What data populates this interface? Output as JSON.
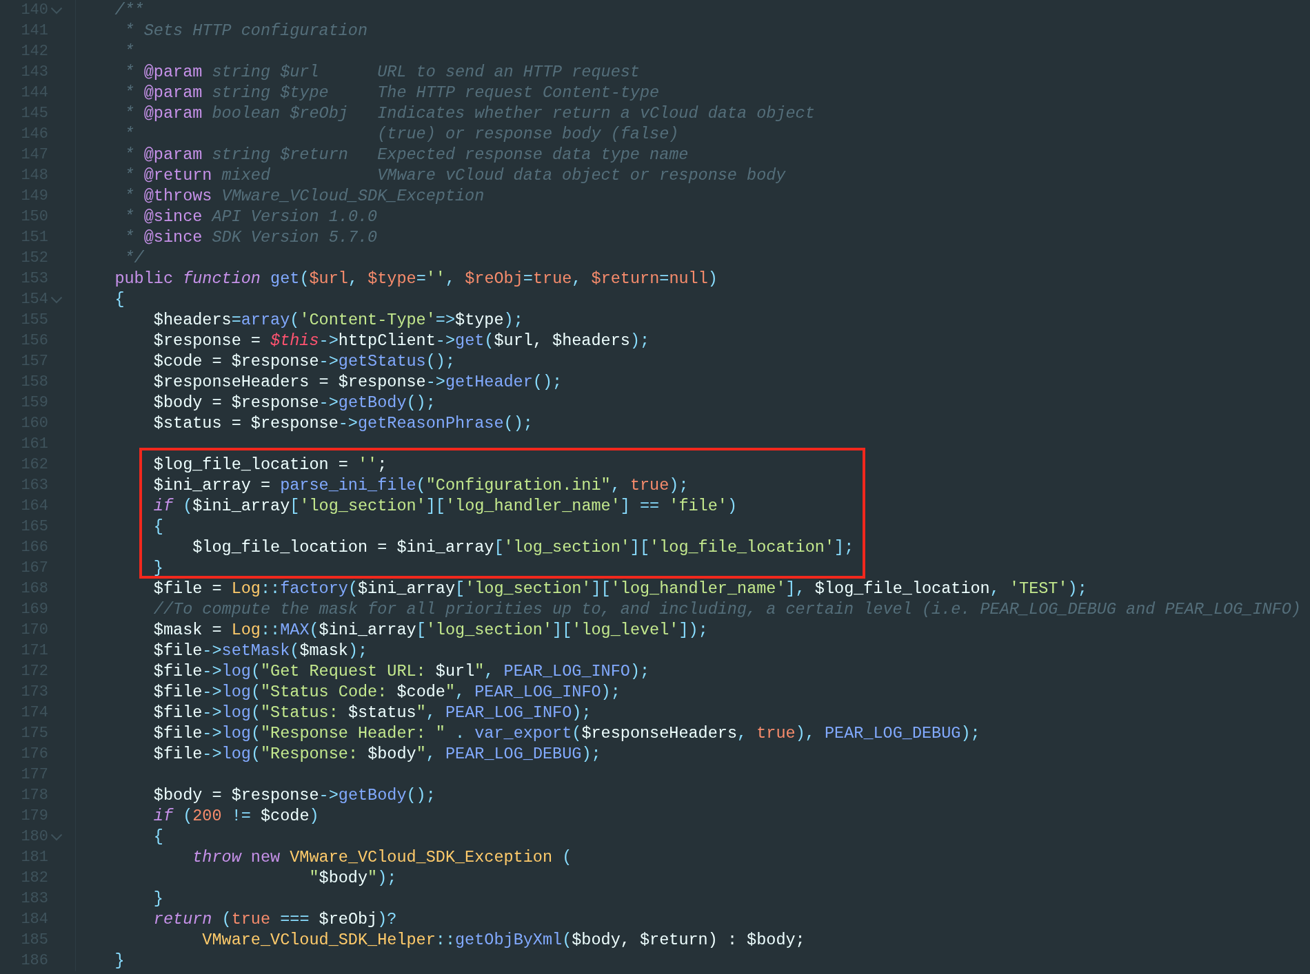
{
  "editor": {
    "segments": [
      {
        "kind": "plain",
        "lines": [
          {
            "number": "140",
            "foldable": true,
            "tokens": [
              {
                "kind": "comment",
                "text": "    /**"
              }
            ]
          },
          {
            "number": "141",
            "foldable": false,
            "tokens": [
              {
                "kind": "comment",
                "text": "     * Sets HTTP configuration"
              }
            ]
          },
          {
            "number": "142",
            "foldable": false,
            "tokens": [
              {
                "kind": "comment",
                "text": "     *"
              }
            ]
          },
          {
            "number": "143",
            "foldable": false,
            "tokens": [
              {
                "kind": "comment",
                "text": "     * "
              },
              {
                "kind": "doc-tag",
                "text": "@param"
              },
              {
                "kind": "comment",
                "text": " string $url      URL to send an HTTP request"
              }
            ]
          },
          {
            "number": "144",
            "foldable": false,
            "tokens": [
              {
                "kind": "comment",
                "text": "     * "
              },
              {
                "kind": "doc-tag",
                "text": "@param"
              },
              {
                "kind": "comment",
                "text": " string $type     The HTTP request Content-type"
              }
            ]
          },
          {
            "number": "145",
            "foldable": false,
            "tokens": [
              {
                "kind": "comment",
                "text": "     * "
              },
              {
                "kind": "doc-tag",
                "text": "@param"
              },
              {
                "kind": "comment",
                "text": " boolean $reObj   Indicates whether return a vCloud data object"
              }
            ]
          },
          {
            "number": "146",
            "foldable": false,
            "tokens": [
              {
                "kind": "comment",
                "text": "     *                         (true) or response body (false)"
              }
            ]
          },
          {
            "number": "147",
            "foldable": false,
            "tokens": [
              {
                "kind": "comment",
                "text": "     * "
              },
              {
                "kind": "doc-tag",
                "text": "@param"
              },
              {
                "kind": "comment",
                "text": " string $return   Expected response data type name"
              }
            ]
          },
          {
            "number": "148",
            "foldable": false,
            "tokens": [
              {
                "kind": "comment",
                "text": "     * "
              },
              {
                "kind": "doc-tag",
                "text": "@return"
              },
              {
                "kind": "comment",
                "text": " mixed           VMware vCloud data object or response body"
              }
            ]
          },
          {
            "number": "149",
            "foldable": false,
            "tokens": [
              {
                "kind": "comment",
                "text": "     * "
              },
              {
                "kind": "doc-tag",
                "text": "@throws"
              },
              {
                "kind": "comment",
                "text": " VMware_VCloud_SDK_Exception"
              }
            ]
          },
          {
            "number": "150",
            "foldable": false,
            "tokens": [
              {
                "kind": "comment",
                "text": "     * "
              },
              {
                "kind": "doc-tag",
                "text": "@since"
              },
              {
                "kind": "comment",
                "text": " API Version 1.0.0"
              }
            ]
          },
          {
            "number": "151",
            "foldable": false,
            "tokens": [
              {
                "kind": "comment",
                "text": "     * "
              },
              {
                "kind": "doc-tag",
                "text": "@since"
              },
              {
                "kind": "comment",
                "text": " SDK Version 5.7.0"
              }
            ]
          },
          {
            "number": "152",
            "foldable": false,
            "tokens": [
              {
                "kind": "comment",
                "text": "     */"
              }
            ]
          },
          {
            "number": "153",
            "foldable": false,
            "tokens": [
              {
                "kind": "storage",
                "text": "    public "
              },
              {
                "kind": "keyword",
                "text": "function "
              },
              {
                "kind": "function",
                "text": "get"
              },
              {
                "kind": "punct",
                "text": "("
              },
              {
                "kind": "param",
                "text": "$url"
              },
              {
                "kind": "punct",
                "text": ", "
              },
              {
                "kind": "param",
                "text": "$type"
              },
              {
                "kind": "punct",
                "text": "="
              },
              {
                "kind": "string",
                "text": "''"
              },
              {
                "kind": "punct",
                "text": ", "
              },
              {
                "kind": "param",
                "text": "$reObj"
              },
              {
                "kind": "punct",
                "text": "="
              },
              {
                "kind": "literal",
                "text": "true"
              },
              {
                "kind": "punct",
                "text": ", "
              },
              {
                "kind": "param",
                "text": "$return"
              },
              {
                "kind": "punct",
                "text": "="
              },
              {
                "kind": "literal",
                "text": "null"
              },
              {
                "kind": "punct",
                "text": ")"
              }
            ]
          },
          {
            "number": "154",
            "foldable": true,
            "tokens": [
              {
                "kind": "punct",
                "text": "    {"
              }
            ]
          },
          {
            "number": "155",
            "foldable": false,
            "tokens": [
              {
                "kind": "plain",
                "text": "        $headers"
              },
              {
                "kind": "punct",
                "text": "="
              },
              {
                "kind": "function",
                "text": "array"
              },
              {
                "kind": "punct",
                "text": "("
              },
              {
                "kind": "string",
                "text": "'Content-Type'"
              },
              {
                "kind": "punct",
                "text": "=>"
              },
              {
                "kind": "plain",
                "text": "$type"
              },
              {
                "kind": "punct",
                "text": ");"
              }
            ]
          },
          {
            "number": "156",
            "foldable": false,
            "tokens": [
              {
                "kind": "plain",
                "text": "        $response = "
              },
              {
                "kind": "this",
                "text": "$this"
              },
              {
                "kind": "punct",
                "text": "->"
              },
              {
                "kind": "plain",
                "text": "httpClient"
              },
              {
                "kind": "punct",
                "text": "->"
              },
              {
                "kind": "function",
                "text": "get"
              },
              {
                "kind": "punct",
                "text": "("
              },
              {
                "kind": "plain",
                "text": "$url, $headers"
              },
              {
                "kind": "punct",
                "text": ");"
              }
            ]
          },
          {
            "number": "157",
            "foldable": false,
            "tokens": [
              {
                "kind": "plain",
                "text": "        $code = $response"
              },
              {
                "kind": "punct",
                "text": "->"
              },
              {
                "kind": "function",
                "text": "getStatus"
              },
              {
                "kind": "punct",
                "text": "();"
              }
            ]
          },
          {
            "number": "158",
            "foldable": false,
            "tokens": [
              {
                "kind": "plain",
                "text": "        $responseHeaders = $response"
              },
              {
                "kind": "punct",
                "text": "->"
              },
              {
                "kind": "function",
                "text": "getHeader"
              },
              {
                "kind": "punct",
                "text": "();"
              }
            ]
          },
          {
            "number": "159",
            "foldable": false,
            "tokens": [
              {
                "kind": "plain",
                "text": "        $body = $response"
              },
              {
                "kind": "punct",
                "text": "->"
              },
              {
                "kind": "function",
                "text": "getBody"
              },
              {
                "kind": "punct",
                "text": "();"
              }
            ]
          },
          {
            "number": "160",
            "foldable": false,
            "tokens": [
              {
                "kind": "plain",
                "text": "        $status = $response"
              },
              {
                "kind": "punct",
                "text": "->"
              },
              {
                "kind": "function",
                "text": "getReasonPhrase"
              },
              {
                "kind": "punct",
                "text": "();"
              }
            ]
          },
          {
            "number": "161",
            "foldable": false
          }
        ]
      },
      {
        "kind": "boxed",
        "lines": [
          {
            "number": "162",
            "foldable": false,
            "tokens": [
              {
                "kind": "plain",
                "text": "        $log_file_location = "
              },
              {
                "kind": "string",
                "text": "''"
              },
              {
                "kind": "plain",
                "text": ";"
              }
            ]
          },
          {
            "number": "163",
            "foldable": false,
            "tokens": [
              {
                "kind": "plain",
                "text": "        $ini_array = "
              },
              {
                "kind": "function",
                "text": "parse_ini_file"
              },
              {
                "kind": "punct",
                "text": "("
              },
              {
                "kind": "string",
                "text": "\"Configuration.ini\""
              },
              {
                "kind": "punct",
                "text": ", "
              },
              {
                "kind": "literal",
                "text": "true"
              },
              {
                "kind": "punct",
                "text": ");"
              }
            ]
          },
          {
            "number": "164",
            "foldable": false,
            "tokens": [
              {
                "kind": "keyword",
                "text": "        if "
              },
              {
                "kind": "punct",
                "text": "("
              },
              {
                "kind": "plain",
                "text": "$ini_array"
              },
              {
                "kind": "punct",
                "text": "["
              },
              {
                "kind": "string",
                "text": "'log_section'"
              },
              {
                "kind": "punct",
                "text": "]["
              },
              {
                "kind": "string",
                "text": "'log_handler_name'"
              },
              {
                "kind": "punct",
                "text": "] == "
              },
              {
                "kind": "string",
                "text": "'file'"
              },
              {
                "kind": "punct",
                "text": ")"
              }
            ]
          },
          {
            "number": "165",
            "foldable": false,
            "tokens": [
              {
                "kind": "punct",
                "text": "        {"
              }
            ]
          },
          {
            "number": "166",
            "foldable": false,
            "tokens": [
              {
                "kind": "plain",
                "text": "            $log_file_location = $ini_array"
              },
              {
                "kind": "punct",
                "text": "["
              },
              {
                "kind": "string",
                "text": "'log_section'"
              },
              {
                "kind": "punct",
                "text": "]["
              },
              {
                "kind": "string",
                "text": "'log_file_location'"
              },
              {
                "kind": "punct",
                "text": "];"
              }
            ]
          },
          {
            "number": "167",
            "foldable": false,
            "tokens": [
              {
                "kind": "punct",
                "text": "        }"
              }
            ]
          }
        ]
      },
      {
        "kind": "plain",
        "lines": [
          {
            "number": "168",
            "foldable": false,
            "tokens": [
              {
                "kind": "plain",
                "text": "        $file = "
              },
              {
                "kind": "class",
                "text": "Log"
              },
              {
                "kind": "punct",
                "text": "::"
              },
              {
                "kind": "function",
                "text": "factory"
              },
              {
                "kind": "punct",
                "text": "("
              },
              {
                "kind": "plain",
                "text": "$ini_array"
              },
              {
                "kind": "punct",
                "text": "["
              },
              {
                "kind": "string",
                "text": "'log_section'"
              },
              {
                "kind": "punct",
                "text": "]["
              },
              {
                "kind": "string",
                "text": "'log_handler_name'"
              },
              {
                "kind": "punct",
                "text": "], "
              },
              {
                "kind": "plain",
                "text": "$log_file_location"
              },
              {
                "kind": "punct",
                "text": ", "
              },
              {
                "kind": "string",
                "text": "'TEST'"
              },
              {
                "kind": "punct",
                "text": ");"
              }
            ]
          },
          {
            "number": "169",
            "foldable": false,
            "tokens": [
              {
                "kind": "comment",
                "text": "        //To compute the mask for all priorities up to, and including, a certain level (i.e. PEAR_LOG_DEBUG and PEAR_LOG_INFO)"
              }
            ]
          },
          {
            "number": "170",
            "foldable": false,
            "tokens": [
              {
                "kind": "plain",
                "text": "        $mask = "
              },
              {
                "kind": "class",
                "text": "Log"
              },
              {
                "kind": "punct",
                "text": "::"
              },
              {
                "kind": "function",
                "text": "MAX"
              },
              {
                "kind": "punct",
                "text": "("
              },
              {
                "kind": "plain",
                "text": "$ini_array"
              },
              {
                "kind": "punct",
                "text": "["
              },
              {
                "kind": "string",
                "text": "'log_section'"
              },
              {
                "kind": "punct",
                "text": "]["
              },
              {
                "kind": "string",
                "text": "'log_level'"
              },
              {
                "kind": "punct",
                "text": "]);"
              }
            ]
          },
          {
            "number": "171",
            "foldable": false,
            "tokens": [
              {
                "kind": "plain",
                "text": "        $file"
              },
              {
                "kind": "punct",
                "text": "->"
              },
              {
                "kind": "function",
                "text": "setMask"
              },
              {
                "kind": "punct",
                "text": "("
              },
              {
                "kind": "plain",
                "text": "$mask"
              },
              {
                "kind": "punct",
                "text": ");"
              }
            ]
          },
          {
            "number": "172",
            "foldable": false,
            "tokens": [
              {
                "kind": "plain",
                "text": "        $file"
              },
              {
                "kind": "punct",
                "text": "->"
              },
              {
                "kind": "function",
                "text": "log"
              },
              {
                "kind": "punct",
                "text": "("
              },
              {
                "kind": "string",
                "text": "\"Get Request URL: "
              },
              {
                "kind": "plain",
                "text": "$url"
              },
              {
                "kind": "string",
                "text": "\""
              },
              {
                "kind": "punct",
                "text": ", "
              },
              {
                "kind": "function",
                "text": "PEAR_LOG_INFO"
              },
              {
                "kind": "punct",
                "text": ");"
              }
            ]
          },
          {
            "number": "173",
            "foldable": false,
            "tokens": [
              {
                "kind": "plain",
                "text": "        $file"
              },
              {
                "kind": "punct",
                "text": "->"
              },
              {
                "kind": "function",
                "text": "log"
              },
              {
                "kind": "punct",
                "text": "("
              },
              {
                "kind": "string",
                "text": "\"Status Code: "
              },
              {
                "kind": "plain",
                "text": "$code"
              },
              {
                "kind": "string",
                "text": "\""
              },
              {
                "kind": "punct",
                "text": ", "
              },
              {
                "kind": "function",
                "text": "PEAR_LOG_INFO"
              },
              {
                "kind": "punct",
                "text": ");"
              }
            ]
          },
          {
            "number": "174",
            "foldable": false,
            "tokens": [
              {
                "kind": "plain",
                "text": "        $file"
              },
              {
                "kind": "punct",
                "text": "->"
              },
              {
                "kind": "function",
                "text": "log"
              },
              {
                "kind": "punct",
                "text": "("
              },
              {
                "kind": "string",
                "text": "\"Status: "
              },
              {
                "kind": "plain",
                "text": "$status"
              },
              {
                "kind": "string",
                "text": "\""
              },
              {
                "kind": "punct",
                "text": ", "
              },
              {
                "kind": "function",
                "text": "PEAR_LOG_INFO"
              },
              {
                "kind": "punct",
                "text": ");"
              }
            ]
          },
          {
            "number": "175",
            "foldable": false,
            "tokens": [
              {
                "kind": "plain",
                "text": "        $file"
              },
              {
                "kind": "punct",
                "text": "->"
              },
              {
                "kind": "function",
                "text": "log"
              },
              {
                "kind": "punct",
                "text": "("
              },
              {
                "kind": "string",
                "text": "\"Response Header: \""
              },
              {
                "kind": "punct",
                "text": " . "
              },
              {
                "kind": "function",
                "text": "var_export"
              },
              {
                "kind": "punct",
                "text": "("
              },
              {
                "kind": "plain",
                "text": "$responseHeaders"
              },
              {
                "kind": "punct",
                "text": ", "
              },
              {
                "kind": "literal",
                "text": "true"
              },
              {
                "kind": "punct",
                "text": "), "
              },
              {
                "kind": "function",
                "text": "PEAR_LOG_DEBUG"
              },
              {
                "kind": "punct",
                "text": ");"
              }
            ]
          },
          {
            "number": "176",
            "foldable": false,
            "tokens": [
              {
                "kind": "plain",
                "text": "        $file"
              },
              {
                "kind": "punct",
                "text": "->"
              },
              {
                "kind": "function",
                "text": "log"
              },
              {
                "kind": "punct",
                "text": "("
              },
              {
                "kind": "string",
                "text": "\"Response: "
              },
              {
                "kind": "plain",
                "text": "$body"
              },
              {
                "kind": "string",
                "text": "\""
              },
              {
                "kind": "punct",
                "text": ", "
              },
              {
                "kind": "function",
                "text": "PEAR_LOG_DEBUG"
              },
              {
                "kind": "punct",
                "text": ");"
              }
            ]
          },
          {
            "number": "177",
            "foldable": false
          },
          {
            "number": "178",
            "foldable": false,
            "tokens": [
              {
                "kind": "plain",
                "text": "        $body = $response"
              },
              {
                "kind": "punct",
                "text": "->"
              },
              {
                "kind": "function",
                "text": "getBody"
              },
              {
                "kind": "punct",
                "text": "();"
              }
            ]
          },
          {
            "number": "179",
            "foldable": false,
            "tokens": [
              {
                "kind": "keyword",
                "text": "        if "
              },
              {
                "kind": "punct",
                "text": "("
              },
              {
                "kind": "literal",
                "text": "200"
              },
              {
                "kind": "punct",
                "text": " != "
              },
              {
                "kind": "plain",
                "text": "$code"
              },
              {
                "kind": "punct",
                "text": ")"
              }
            ]
          },
          {
            "number": "180",
            "foldable": true,
            "tokens": [
              {
                "kind": "punct",
                "text": "        {"
              }
            ]
          },
          {
            "number": "181",
            "foldable": false,
            "tokens": [
              {
                "kind": "keyword",
                "text": "            throw "
              },
              {
                "kind": "storage",
                "text": "new "
              },
              {
                "kind": "class",
                "text": "VMware_VCloud_SDK_Exception"
              },
              {
                "kind": "punct",
                "text": " ("
              }
            ]
          },
          {
            "number": "182",
            "foldable": false,
            "tokens": [
              {
                "kind": "string",
                "text": "                        \""
              },
              {
                "kind": "plain",
                "text": "$body"
              },
              {
                "kind": "string",
                "text": "\""
              },
              {
                "kind": "punct",
                "text": ");"
              }
            ]
          },
          {
            "number": "183",
            "foldable": false,
            "tokens": [
              {
                "kind": "punct",
                "text": "        }"
              }
            ]
          },
          {
            "number": "184",
            "foldable": false,
            "tokens": [
              {
                "kind": "keyword",
                "text": "        return "
              },
              {
                "kind": "punct",
                "text": "("
              },
              {
                "kind": "literal",
                "text": "true"
              },
              {
                "kind": "punct",
                "text": " === "
              },
              {
                "kind": "plain",
                "text": "$reObj"
              },
              {
                "kind": "punct",
                "text": ")?"
              }
            ]
          },
          {
            "number": "185",
            "foldable": false,
            "tokens": [
              {
                "kind": "class",
                "text": "             VMware_VCloud_SDK_Helper"
              },
              {
                "kind": "punct",
                "text": "::"
              },
              {
                "kind": "function",
                "text": "getObjByXml"
              },
              {
                "kind": "punct",
                "text": "("
              },
              {
                "kind": "plain",
                "text": "$body, $return) : $body;"
              }
            ]
          },
          {
            "number": "186",
            "foldable": false,
            "tokens": [
              {
                "kind": "punct",
                "text": "    }"
              }
            ]
          }
        ]
      }
    ]
  }
}
